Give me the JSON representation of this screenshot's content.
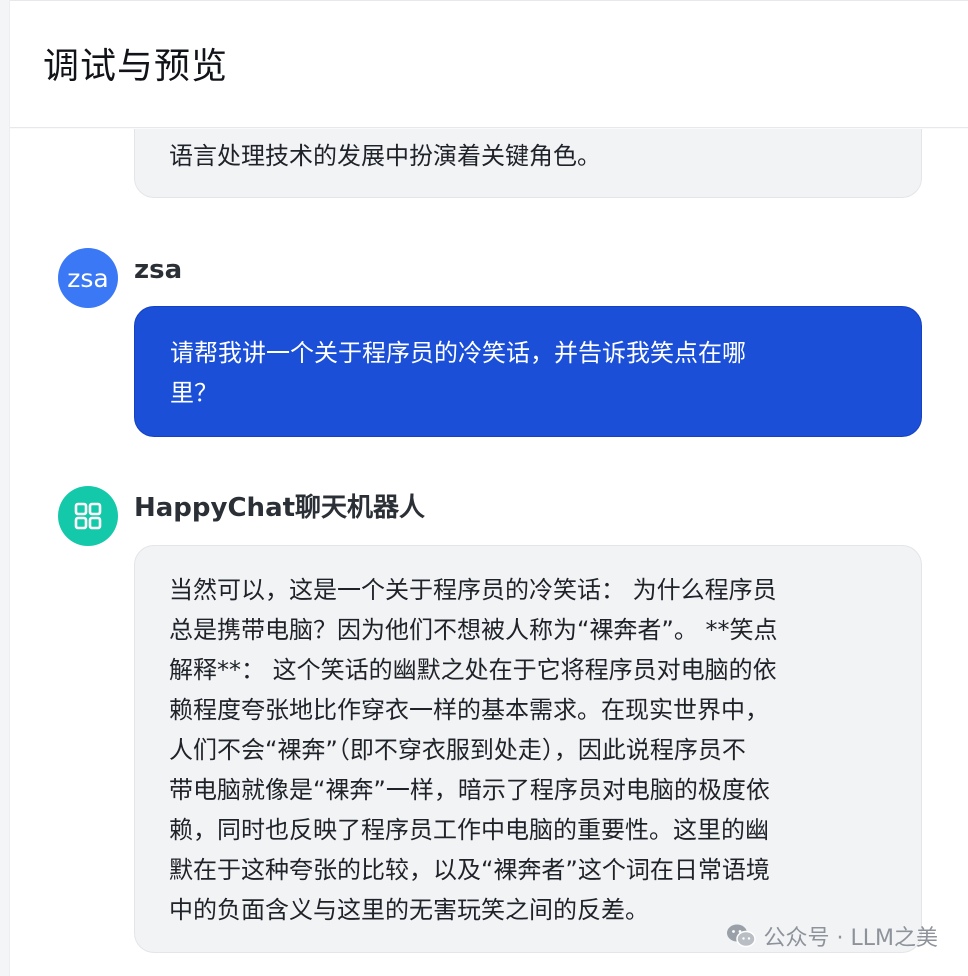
{
  "header": {
    "title": "调试与预览"
  },
  "messages": {
    "previous_ai_tail": "语言处理技术的发展中扮演着关键角色。",
    "user": {
      "avatar_text": "zsa",
      "name": "zsa",
      "lines": [
        "请帮我讲一个关于程序员的冷笑话，并告诉我笑点在哪",
        "里？"
      ]
    },
    "bot": {
      "name": "HappyChat聊天机器人",
      "avatar_icon": "grid-icon",
      "lines": [
        "当然可以，这是一个关于程序员的冷笑话： 为什么程序员",
        "总是携带电脑？因为他们不想被人称为“裸奔者”。 **笑点",
        "解释**： 这个笑话的幽默之处在于它将程序员对电脑的依",
        "赖程度夸张地比作穿衣一样的基本需求。在现实世界中，",
        "人们不会“裸奔”（即不穿衣服到处走），因此说程序员不",
        "带电脑就像是“裸奔”一样，暗示了程序员对电脑的极度依",
        "赖，同时也反映了程序员工作中电脑的重要性。这里的幽",
        "默在于这种夸张的比较，以及“裸奔者”这个词在日常语境",
        "中的负面含义与这里的无害玩笑之间的反差。"
      ]
    }
  },
  "watermark": {
    "text": "公众号 · LLM之美",
    "icon": "wechat-icon"
  },
  "colors": {
    "user_bubble": "#1b4fd8",
    "user_avatar": "#3a78f5",
    "bot_avatar": "#14c9a9",
    "ai_bubble": "#f2f3f5"
  }
}
